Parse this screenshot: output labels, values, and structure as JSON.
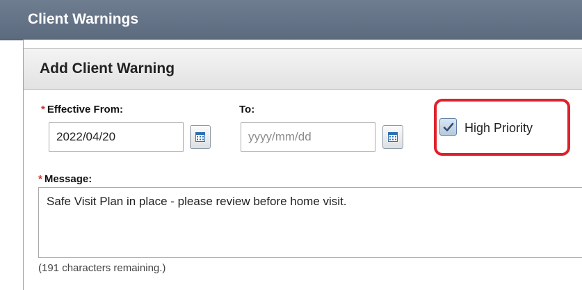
{
  "window": {
    "title": "Client Warnings"
  },
  "panel": {
    "title": "Add Client Warning"
  },
  "form": {
    "required_marker": "*",
    "effective_from": {
      "label": "Effective From:",
      "value": "2022/04/20"
    },
    "to": {
      "label": "To:",
      "value": "",
      "placeholder": "yyyy/mm/dd"
    },
    "high_priority": {
      "label": "High Priority",
      "checked": true
    },
    "message": {
      "label": "Message:",
      "value": "Safe Visit Plan in place - please review before home visit."
    },
    "remaining_text": "(191 characters remaining.)"
  },
  "colors": {
    "title_bar": "#5b6a7e",
    "required": "#d0342c",
    "highlight": "#e0202a",
    "checkbox": "#b6c9dd"
  },
  "icons": {
    "calendar": "calendar-icon",
    "check": "check-icon"
  }
}
